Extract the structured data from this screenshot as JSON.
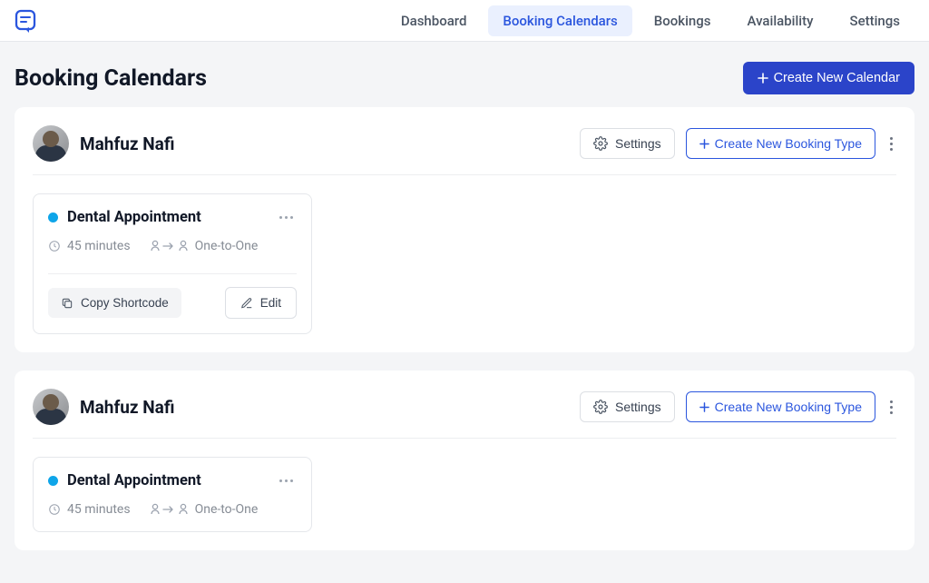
{
  "nav": {
    "items": [
      {
        "label": "Dashboard"
      },
      {
        "label": "Booking Calendars"
      },
      {
        "label": "Bookings"
      },
      {
        "label": "Availability"
      },
      {
        "label": "Settings"
      }
    ]
  },
  "page": {
    "title": "Booking Calendars",
    "create_label": "Create New Calendar"
  },
  "calendars": [
    {
      "owner": "Mahfuz Nafi",
      "settings_label": "Settings",
      "new_type_label": "Create New Booking Type",
      "booking_type": {
        "title": "Dental Appointment",
        "duration": "45 minutes",
        "mode": "One-to-One",
        "copy_shortcode_label": "Copy Shortcode",
        "edit_label": "Edit"
      }
    },
    {
      "owner": "Mahfuz Nafi",
      "settings_label": "Settings",
      "new_type_label": "Create New Booking Type",
      "booking_type": {
        "title": "Dental Appointment",
        "duration": "45 minutes",
        "mode": "One-to-One"
      }
    }
  ]
}
